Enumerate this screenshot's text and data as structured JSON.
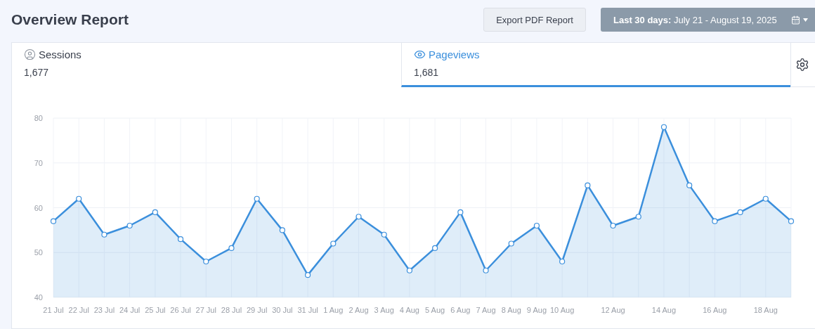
{
  "header": {
    "title": "Overview Report",
    "export_button": "Export PDF Report",
    "date_range": {
      "label": "Last 30 days:",
      "value": "July 21 - August 19, 2025"
    }
  },
  "tabs": [
    {
      "label": "Sessions",
      "value": "1,677",
      "kind": "person",
      "selected": false
    },
    {
      "label": "Pageviews",
      "value": "1,681",
      "kind": "views",
      "selected": true
    }
  ],
  "chart_data": {
    "type": "area",
    "categories": [
      "21 Jul",
      "22 Jul",
      "23 Jul",
      "24 Jul",
      "25 Jul",
      "26 Jul",
      "27 Jul",
      "28 Jul",
      "29 Jul",
      "30 Jul",
      "31 Jul",
      "1 Aug",
      "2 Aug",
      "3 Aug",
      "4 Aug",
      "5 Aug",
      "6 Aug",
      "7 Aug",
      "8 Aug",
      "9 Aug",
      "10 Aug",
      null,
      "12 Aug",
      null,
      "14 Aug",
      null,
      "16 Aug",
      null,
      "18 Aug",
      null
    ],
    "series": [
      {
        "color": "#3b8fdc",
        "values": [
          57,
          62,
          54,
          56,
          59,
          53,
          48,
          51,
          62,
          55,
          45,
          52,
          58,
          54,
          46,
          51,
          59,
          46,
          52,
          56,
          48,
          65,
          56,
          58,
          78,
          65,
          57,
          59,
          62,
          57
        ]
      }
    ],
    "ylim": [
      40,
      80
    ],
    "yticks": [
      40,
      50,
      60,
      70,
      80
    ],
    "grid": true
  }
}
